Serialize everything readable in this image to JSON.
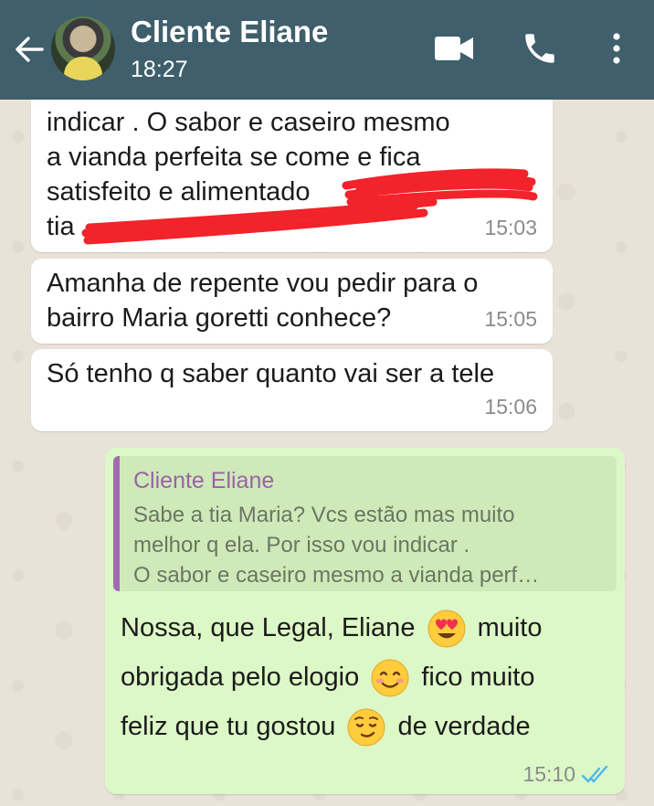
{
  "header": {
    "contact_name": "Cliente Eliane",
    "status": "18:27",
    "icons": [
      "back-arrow-icon",
      "avatar",
      "video-call-icon",
      "phone-icon",
      "more-vert-icon"
    ],
    "bg_color": "#3e5f6b"
  },
  "messages": [
    {
      "direction": "incoming",
      "lines": [
        "indicar . O sabor e caseiro mesmo",
        "a vianda perfeita se come e fica",
        "satisfeito e alimentado",
        "tia"
      ],
      "redacted": true,
      "time": "15:03"
    },
    {
      "direction": "incoming",
      "lines": [
        "Amanha de repente vou pedir para o",
        "bairro Maria goretti conhece?"
      ],
      "time": "15:05"
    },
    {
      "direction": "incoming",
      "lines": [
        "Só tenho q saber quanto vai ser a tele"
      ],
      "time": "15:06"
    },
    {
      "direction": "outgoing",
      "quote": {
        "author": "Cliente Eliane",
        "lines": [
          "Sabe a tia Maria? Vcs estão mas muito",
          "melhor q ela. Por isso vou indicar .",
          "O sabor e caseiro mesmo a vianda perf…"
        ]
      },
      "reply": {
        "line1_a": "Nossa, que Legal, Eliane",
        "line1_b": "muito",
        "line2_a": "obrigada pelo elogio",
        "line2_b": "fico muito",
        "line3_a": "feliz que tu gostou",
        "line3_b": "de verdade"
      },
      "emojis": [
        "heart-eyes-emoji",
        "smiling-blush-emoji",
        "relieved-emoji"
      ],
      "time": "15:10",
      "status_icon": "double-check-read-icon"
    }
  ],
  "colors": {
    "outgoing_bubble": "#dcf8c6",
    "incoming_bubble": "#ffffff",
    "quote_bar": "#a36bb1",
    "read_ticks": "#4fb6ec",
    "redaction": "#f2232a"
  }
}
